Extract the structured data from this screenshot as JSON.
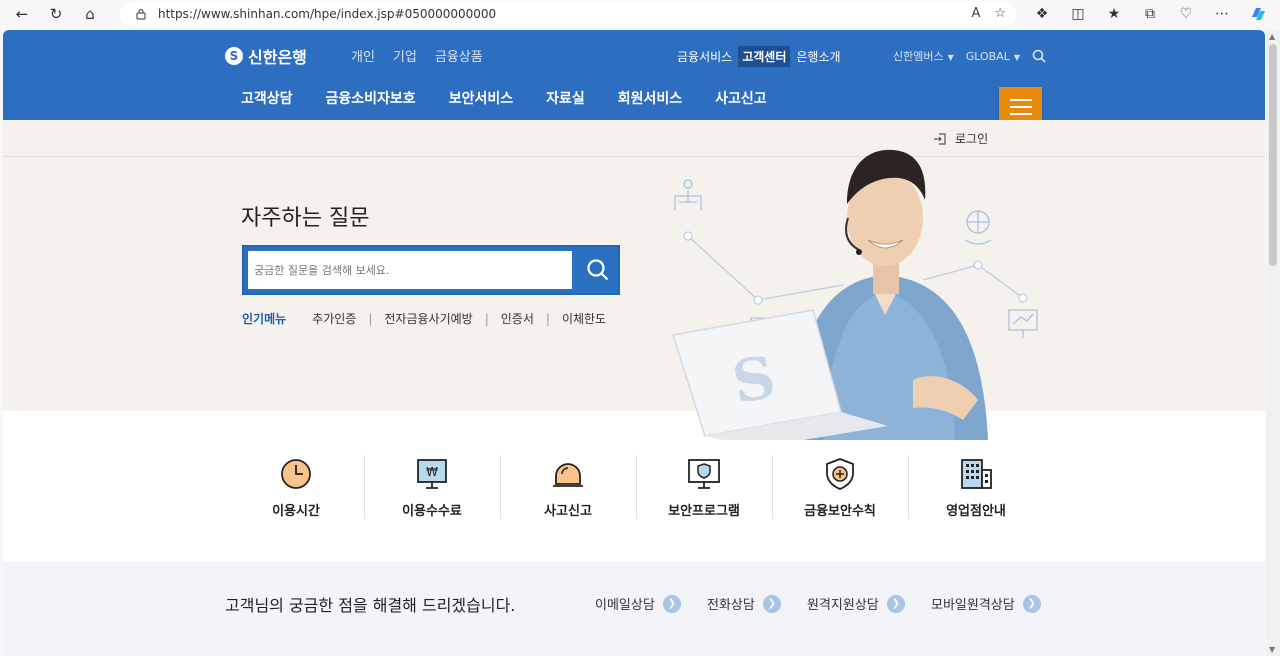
{
  "browser": {
    "url": "https://www.shinhan.com/hpe/index.jsp#050000000000",
    "read_aloud_label": "A"
  },
  "header": {
    "logo_text": "신한은행",
    "top_links": [
      "개인",
      "기업",
      "금융상품"
    ],
    "center_links": [
      "금융서비스",
      "고객센터",
      "은행소개"
    ],
    "right_links": [
      "신한멤버스",
      "GLOBAL"
    ],
    "main_nav": [
      "고객상담",
      "금융소비자보호",
      "보안서비스",
      "자료실",
      "회원서비스",
      "사고신고"
    ]
  },
  "hero": {
    "login_label": "로그인",
    "faq_title": "자주하는 질문",
    "search_placeholder": "궁금한 질문을 검색해 보세요.",
    "popular_label": "인기메뉴",
    "popular_items": [
      "추가인증",
      "전자금융사기예방",
      "인증서",
      "이체한도"
    ]
  },
  "quick_menu": [
    {
      "label": "이용시간",
      "icon": "clock-icon"
    },
    {
      "label": "이용수수료",
      "icon": "monitor-won-icon"
    },
    {
      "label": "사고신고",
      "icon": "siren-icon"
    },
    {
      "label": "보안프로그램",
      "icon": "monitor-shield-icon"
    },
    {
      "label": "금융보안수칙",
      "icon": "shield-plus-icon"
    },
    {
      "label": "영업점안내",
      "icon": "building-icon"
    }
  ],
  "bottom": {
    "title": "고객님의 궁금한 점을 해결해 드리겠습니다.",
    "consult_links": [
      "이메일상담",
      "전화상담",
      "원격지원상담",
      "모바일원격상담"
    ]
  },
  "colors": {
    "brand_blue": "#2e6ec1",
    "menu_orange": "#e88a0c",
    "hero_bg": "#f5f1ec"
  }
}
